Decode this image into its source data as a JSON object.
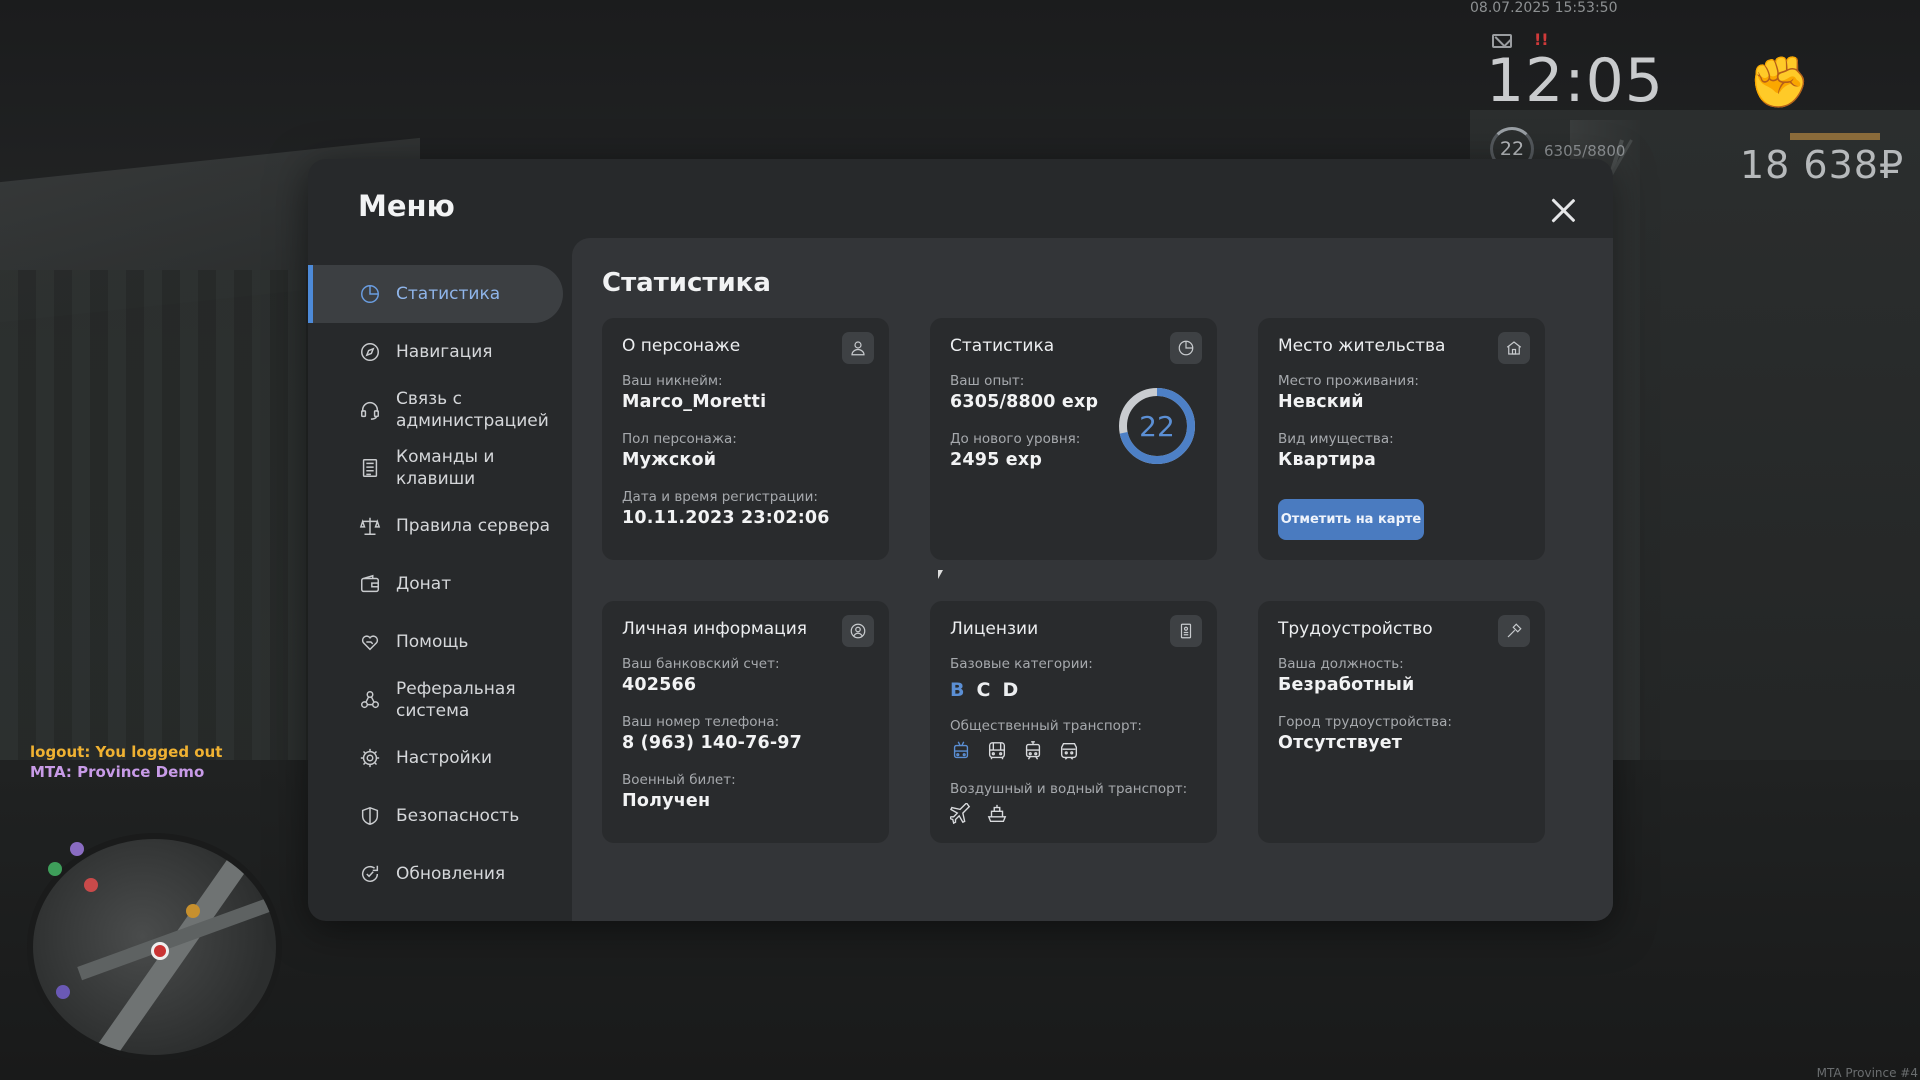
{
  "hud": {
    "datetime": "08.07.2025 15:53:50",
    "alert": "!!",
    "clock": "12:05",
    "level": "22",
    "exp": "6305/8800",
    "money": "18 638₽"
  },
  "chat": {
    "line1": "logout: You logged out",
    "line2": "MTA: Province Demo"
  },
  "watermark": "MTA Province #4",
  "menu": {
    "title": "Меню",
    "sidebar": [
      {
        "label": "Статистика",
        "icon": "pie-chart-icon",
        "active": true
      },
      {
        "label": "Навигация",
        "icon": "compass-icon"
      },
      {
        "label": "Связь с администрацией",
        "icon": "headset-icon"
      },
      {
        "label": "Команды и клавиши",
        "icon": "document-list-icon"
      },
      {
        "label": "Правила сервера",
        "icon": "scales-icon"
      },
      {
        "label": "Донат",
        "icon": "wallet-icon"
      },
      {
        "label": "Помощь",
        "icon": "heart-hand-icon"
      },
      {
        "label": "Реферальная система",
        "icon": "referral-icon"
      },
      {
        "label": "Настройки",
        "icon": "gear-icon"
      },
      {
        "label": "Безопасность",
        "icon": "shield-icon"
      },
      {
        "label": "Обновления",
        "icon": "refresh-check-icon"
      }
    ]
  },
  "content": {
    "title": "Статистика",
    "character": {
      "title": "О персонаже",
      "nickname_label": "Ваш никнейм:",
      "nickname": "Marco_Moretti",
      "gender_label": "Пол персонажа:",
      "gender": "Мужской",
      "reg_label": "Дата и время регистрации:",
      "reg": "10.11.2023 23:02:06"
    },
    "stats": {
      "title": "Статистика",
      "exp_label": "Ваш опыт:",
      "exp": "6305/8800 exp",
      "next_label": "До нового уровня:",
      "next": "2495 exp",
      "level": "22",
      "progress": 0.7165
    },
    "residence": {
      "title": "Место жительства",
      "place_label": "Место проживания:",
      "place": "Невский",
      "type_label": "Вид имущества:",
      "type": "Квартира",
      "button": "Отметить на карте"
    },
    "personal": {
      "title": "Личная информация",
      "bank_label": "Ваш банковский счет:",
      "bank": "402566",
      "phone_label": "Ваш номер телефона:",
      "phone": "8 (963) 140-76-97",
      "military_label": "Военный билет:",
      "military": "Получен"
    },
    "licenses": {
      "title": "Лицензии",
      "base_label": "Базовые категории:",
      "categories": [
        "B",
        "C",
        "D"
      ],
      "public_label": "Общественный транспорт:",
      "public_icons": [
        "trolleybus-icon",
        "bus-icon",
        "tram-icon",
        "metro-icon"
      ],
      "air_label": "Воздушный и водный транспорт:",
      "air_icons": [
        "plane-icon",
        "ship-icon"
      ]
    },
    "employment": {
      "title": "Трудоустройство",
      "position_label": "Ваша должность:",
      "position": "Безработный",
      "city_label": "Город трудоустройства:",
      "city": "Отсутствует"
    }
  }
}
